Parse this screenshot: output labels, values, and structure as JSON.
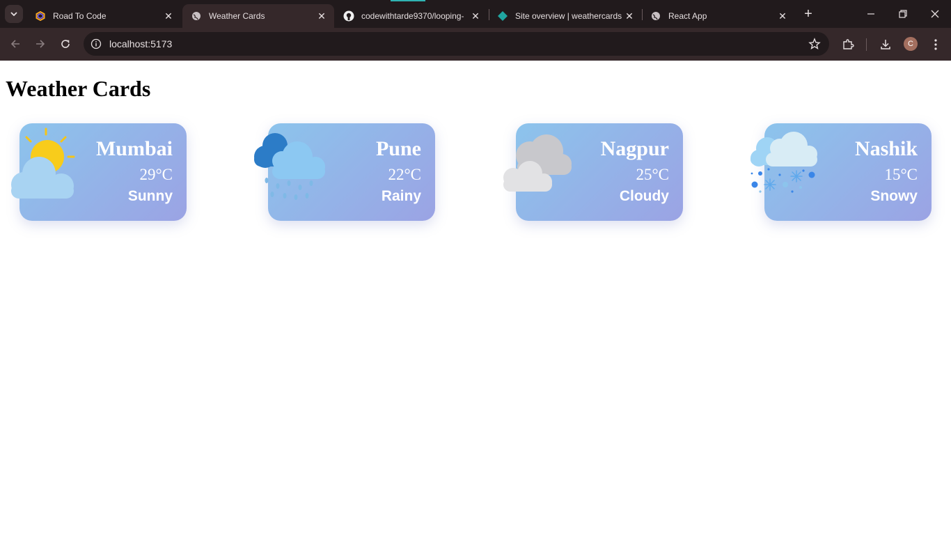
{
  "browser": {
    "tabs": [
      {
        "title": "Road To Code",
        "favicon": "hexagon-icon",
        "active": false
      },
      {
        "title": "Weather Cards",
        "favicon": "globe-icon",
        "active": true
      },
      {
        "title": "codewithtarde9370/looping-",
        "favicon": "github-icon",
        "active": false
      },
      {
        "title": "Site overview | weathercards",
        "favicon": "netlify-icon",
        "active": false
      },
      {
        "title": "React App",
        "favicon": "globe-icon",
        "active": false
      }
    ],
    "url": "localhost:5173",
    "profile_initial": "C"
  },
  "page": {
    "title": "Weather Cards",
    "cards": [
      {
        "city": "Mumbai",
        "temp": "29°C",
        "condition": "Sunny",
        "icon": "sun-cloud-icon"
      },
      {
        "city": "Pune",
        "temp": "22°C",
        "condition": "Rainy",
        "icon": "rain-cloud-icon"
      },
      {
        "city": "Nagpur",
        "temp": "25°C",
        "condition": "Cloudy",
        "icon": "clouds-icon"
      },
      {
        "city": "Nashik",
        "temp": "15°C",
        "condition": "Snowy",
        "icon": "snow-cloud-icon"
      }
    ]
  },
  "colors": {
    "card_gradient_start": "#8cc4ec",
    "card_gradient_end": "#9ba3e4",
    "chrome_bg": "#35282a",
    "tabstrip_bg": "#211a1c"
  }
}
